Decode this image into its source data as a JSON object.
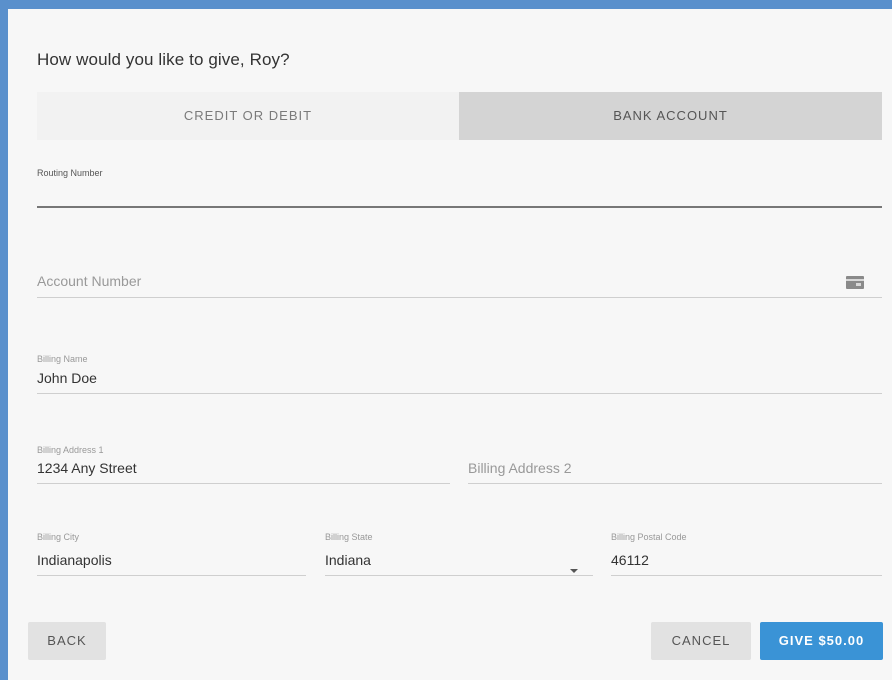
{
  "title": "How would you like to give, Roy?",
  "tabs": [
    {
      "label": "CREDIT OR DEBIT",
      "active": false
    },
    {
      "label": "BANK ACCOUNT",
      "active": true
    }
  ],
  "fields": {
    "routing_number": {
      "label": "Routing Number",
      "value": ""
    },
    "account_number": {
      "placeholder": "Account Number",
      "value": "",
      "icon": "card-icon"
    },
    "billing_name": {
      "label": "Billing Name",
      "value": "John Doe"
    },
    "billing_address_1": {
      "label": "Billing Address 1",
      "value": "1234 Any Street"
    },
    "billing_address_2": {
      "placeholder": "Billing Address 2",
      "value": ""
    },
    "billing_city": {
      "label": "Billing City",
      "value": "Indianapolis"
    },
    "billing_state": {
      "label": "Billing State",
      "value": "Indiana"
    },
    "billing_postal_code": {
      "label": "Billing Postal Code",
      "value": "46112"
    }
  },
  "buttons": {
    "back": "BACK",
    "cancel": "CANCEL",
    "give": "GIVE $50.00"
  },
  "colors": {
    "frame": "#5a90cc",
    "primary_button": "#3a93d6",
    "active_tab": "#d4d4d4"
  }
}
